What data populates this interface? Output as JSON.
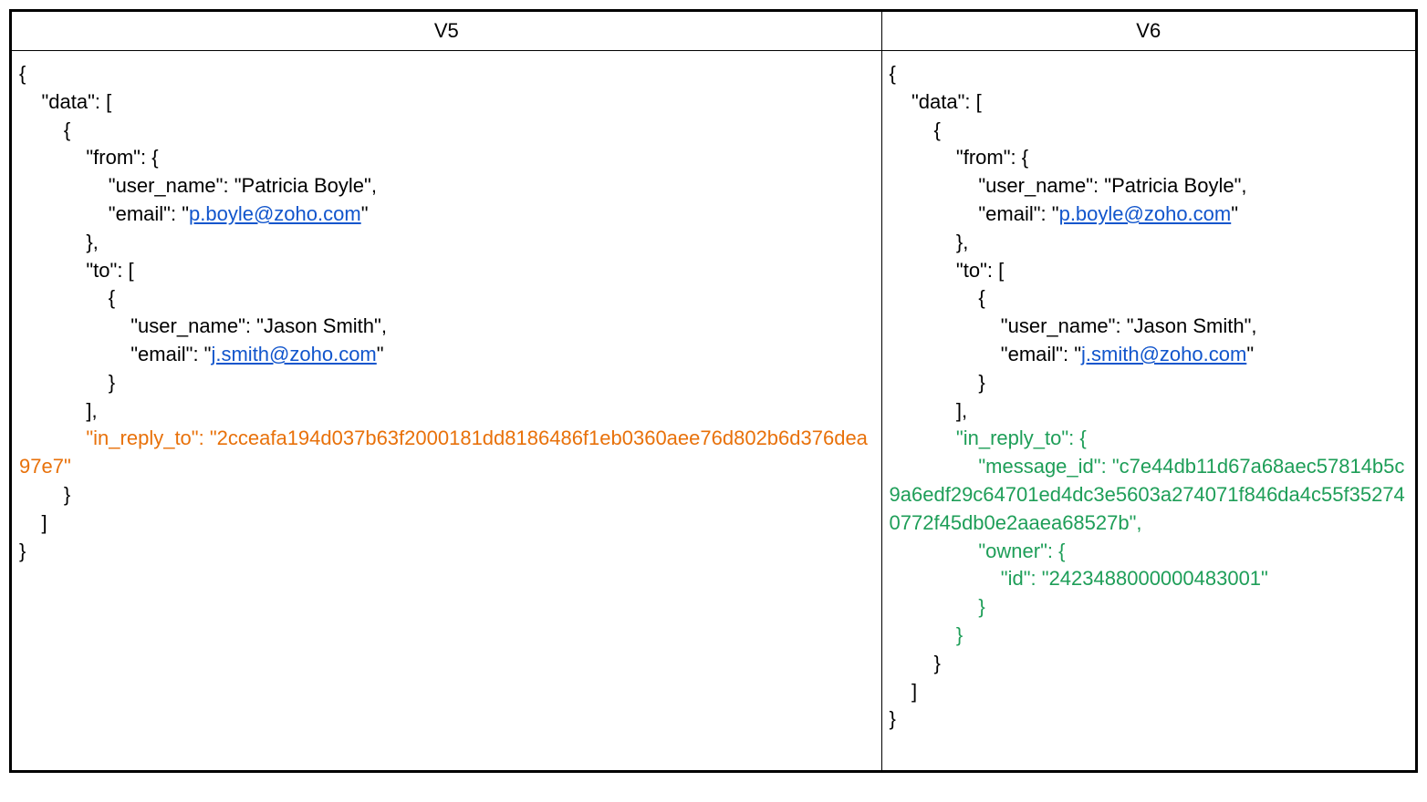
{
  "headers": {
    "v5": "V5",
    "v6": "V6"
  },
  "v5": {
    "line1": "{",
    "line2": "    \"data\": [",
    "line3": "        {",
    "line4": "            \"from\": {",
    "line5_prefix": "                \"user_name\": \"",
    "line5_value": "Patricia Boyle",
    "line5_suffix": "\",",
    "line6_prefix": "                \"email\": \"",
    "line6_link": "p.boyle@zoho.com",
    "line6_suffix": "\"",
    "line7": "            },",
    "line8": "            \"to\": [",
    "line9": "                {",
    "line10_prefix": "                    \"user_name\": \"",
    "line10_value": "Jason Smith",
    "line10_suffix": "\",",
    "line11_prefix": "                    \"email\": \"",
    "line11_link": "j.smith@zoho.com",
    "line11_suffix": "\"",
    "line12": "                }",
    "line13": "            ],",
    "line14_orange": "            \"in_reply_to\": \"2cceafa194d037b63f2000181dd8186486f1eb0360aee76d802b6d376dea97e7\"",
    "line15": "        }",
    "line16": "    ]",
    "line17": "}"
  },
  "v6": {
    "line1": "{",
    "line2": "    \"data\": [",
    "line3": "        {",
    "line4": "            \"from\": {",
    "line5_prefix": "                \"user_name\": \"",
    "line5_value": "Patricia Boyle",
    "line5_suffix": "\",",
    "line6_prefix": "                \"email\": \"",
    "line6_link": "p.boyle@zoho.com",
    "line6_suffix": "\"",
    "line7": "            },",
    "line8": "            \"to\": [",
    "line9": "                {",
    "line10_prefix": "                    \"user_name\": \"",
    "line10_value": "Jason Smith",
    "line10_suffix": "\",",
    "line11_prefix": "                    \"email\": \"",
    "line11_link": "j.smith@zoho.com",
    "line11_suffix": "\"",
    "line12": "                }",
    "line13": "            ],",
    "line14_green": "            \"in_reply_to\": {",
    "line15_green": "                \"message_id\": \"c7e44db11d67a68aec57814b5c9a6edf29c64701ed4dc3e5603a274071f846da4c55f352740772f45db0e2aaea68527b\",",
    "line16_green": "                \"owner\": {",
    "line17_green": "                    \"id\": \"2423488000000483001\"",
    "line18_green": "                }",
    "line19_green": "            }",
    "line20": "        }",
    "line21": "    ]",
    "line22": "}"
  }
}
